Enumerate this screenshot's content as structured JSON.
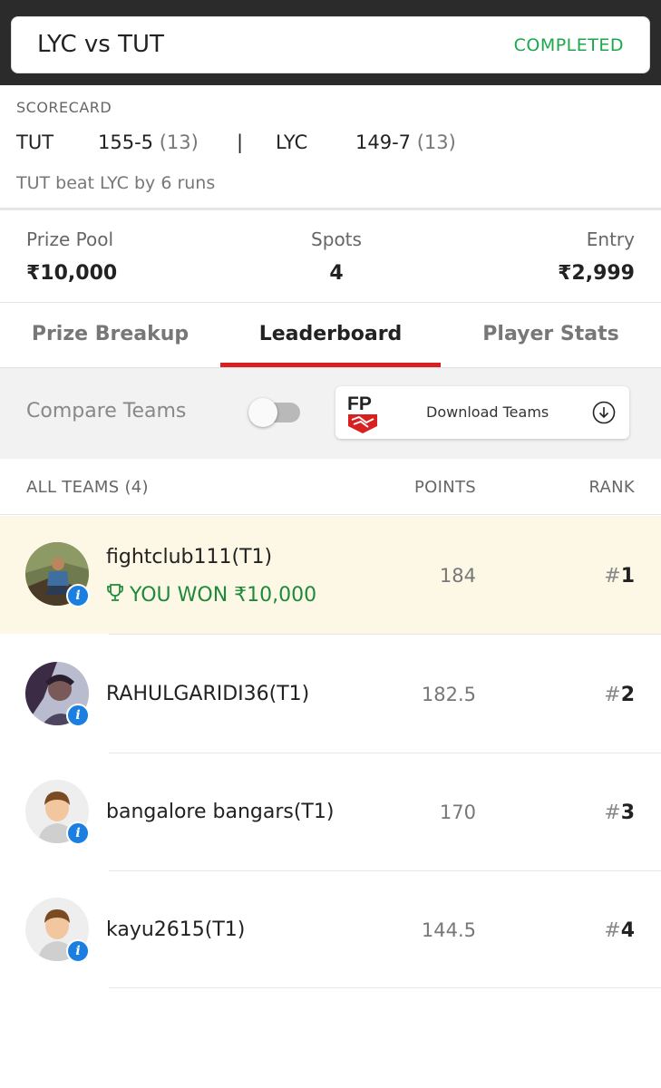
{
  "header": {
    "match_title": "LYC vs TUT",
    "status": "COMPLETED"
  },
  "scorecard": {
    "label": "SCORECARD",
    "team1": {
      "name": "TUT",
      "score": "155-5",
      "overs": "(13)"
    },
    "separator": "|",
    "team2": {
      "name": "LYC",
      "score": "149-7",
      "overs": "(13)"
    },
    "result": "TUT beat LYC by 6 runs"
  },
  "contest": {
    "prize_pool_label": "Prize Pool",
    "prize_pool": "₹10,000",
    "spots_label": "Spots",
    "spots": "4",
    "entry_label": "Entry",
    "entry": "₹2,999"
  },
  "tabs": [
    {
      "label": "Prize Breakup",
      "active": false
    },
    {
      "label": "Leaderboard",
      "active": true
    },
    {
      "label": "Player Stats",
      "active": false
    }
  ],
  "compare": {
    "label": "Compare Teams",
    "enabled": false
  },
  "download": {
    "label": "Download Teams",
    "logo_text": "FP"
  },
  "list_header": {
    "teams": "ALL TEAMS (4)",
    "points": "POINTS",
    "rank": "RANK"
  },
  "teams": [
    {
      "name": "fightclub111(T1)",
      "won": "YOU WON ₹10,000",
      "points": "184",
      "rank": "1",
      "highlight": true
    },
    {
      "name": "RAHULGARIDI36(T1)",
      "points": "182.5",
      "rank": "2"
    },
    {
      "name": "bangalore bangars(T1)",
      "points": "170",
      "rank": "3"
    },
    {
      "name": "kayu2615(T1)",
      "points": "144.5",
      "rank": "4"
    }
  ],
  "colors": {
    "accent_red": "#d92020",
    "status_green": "#19a84a",
    "won_green": "#1d8a3a",
    "info_blue": "#1a7fe0"
  }
}
